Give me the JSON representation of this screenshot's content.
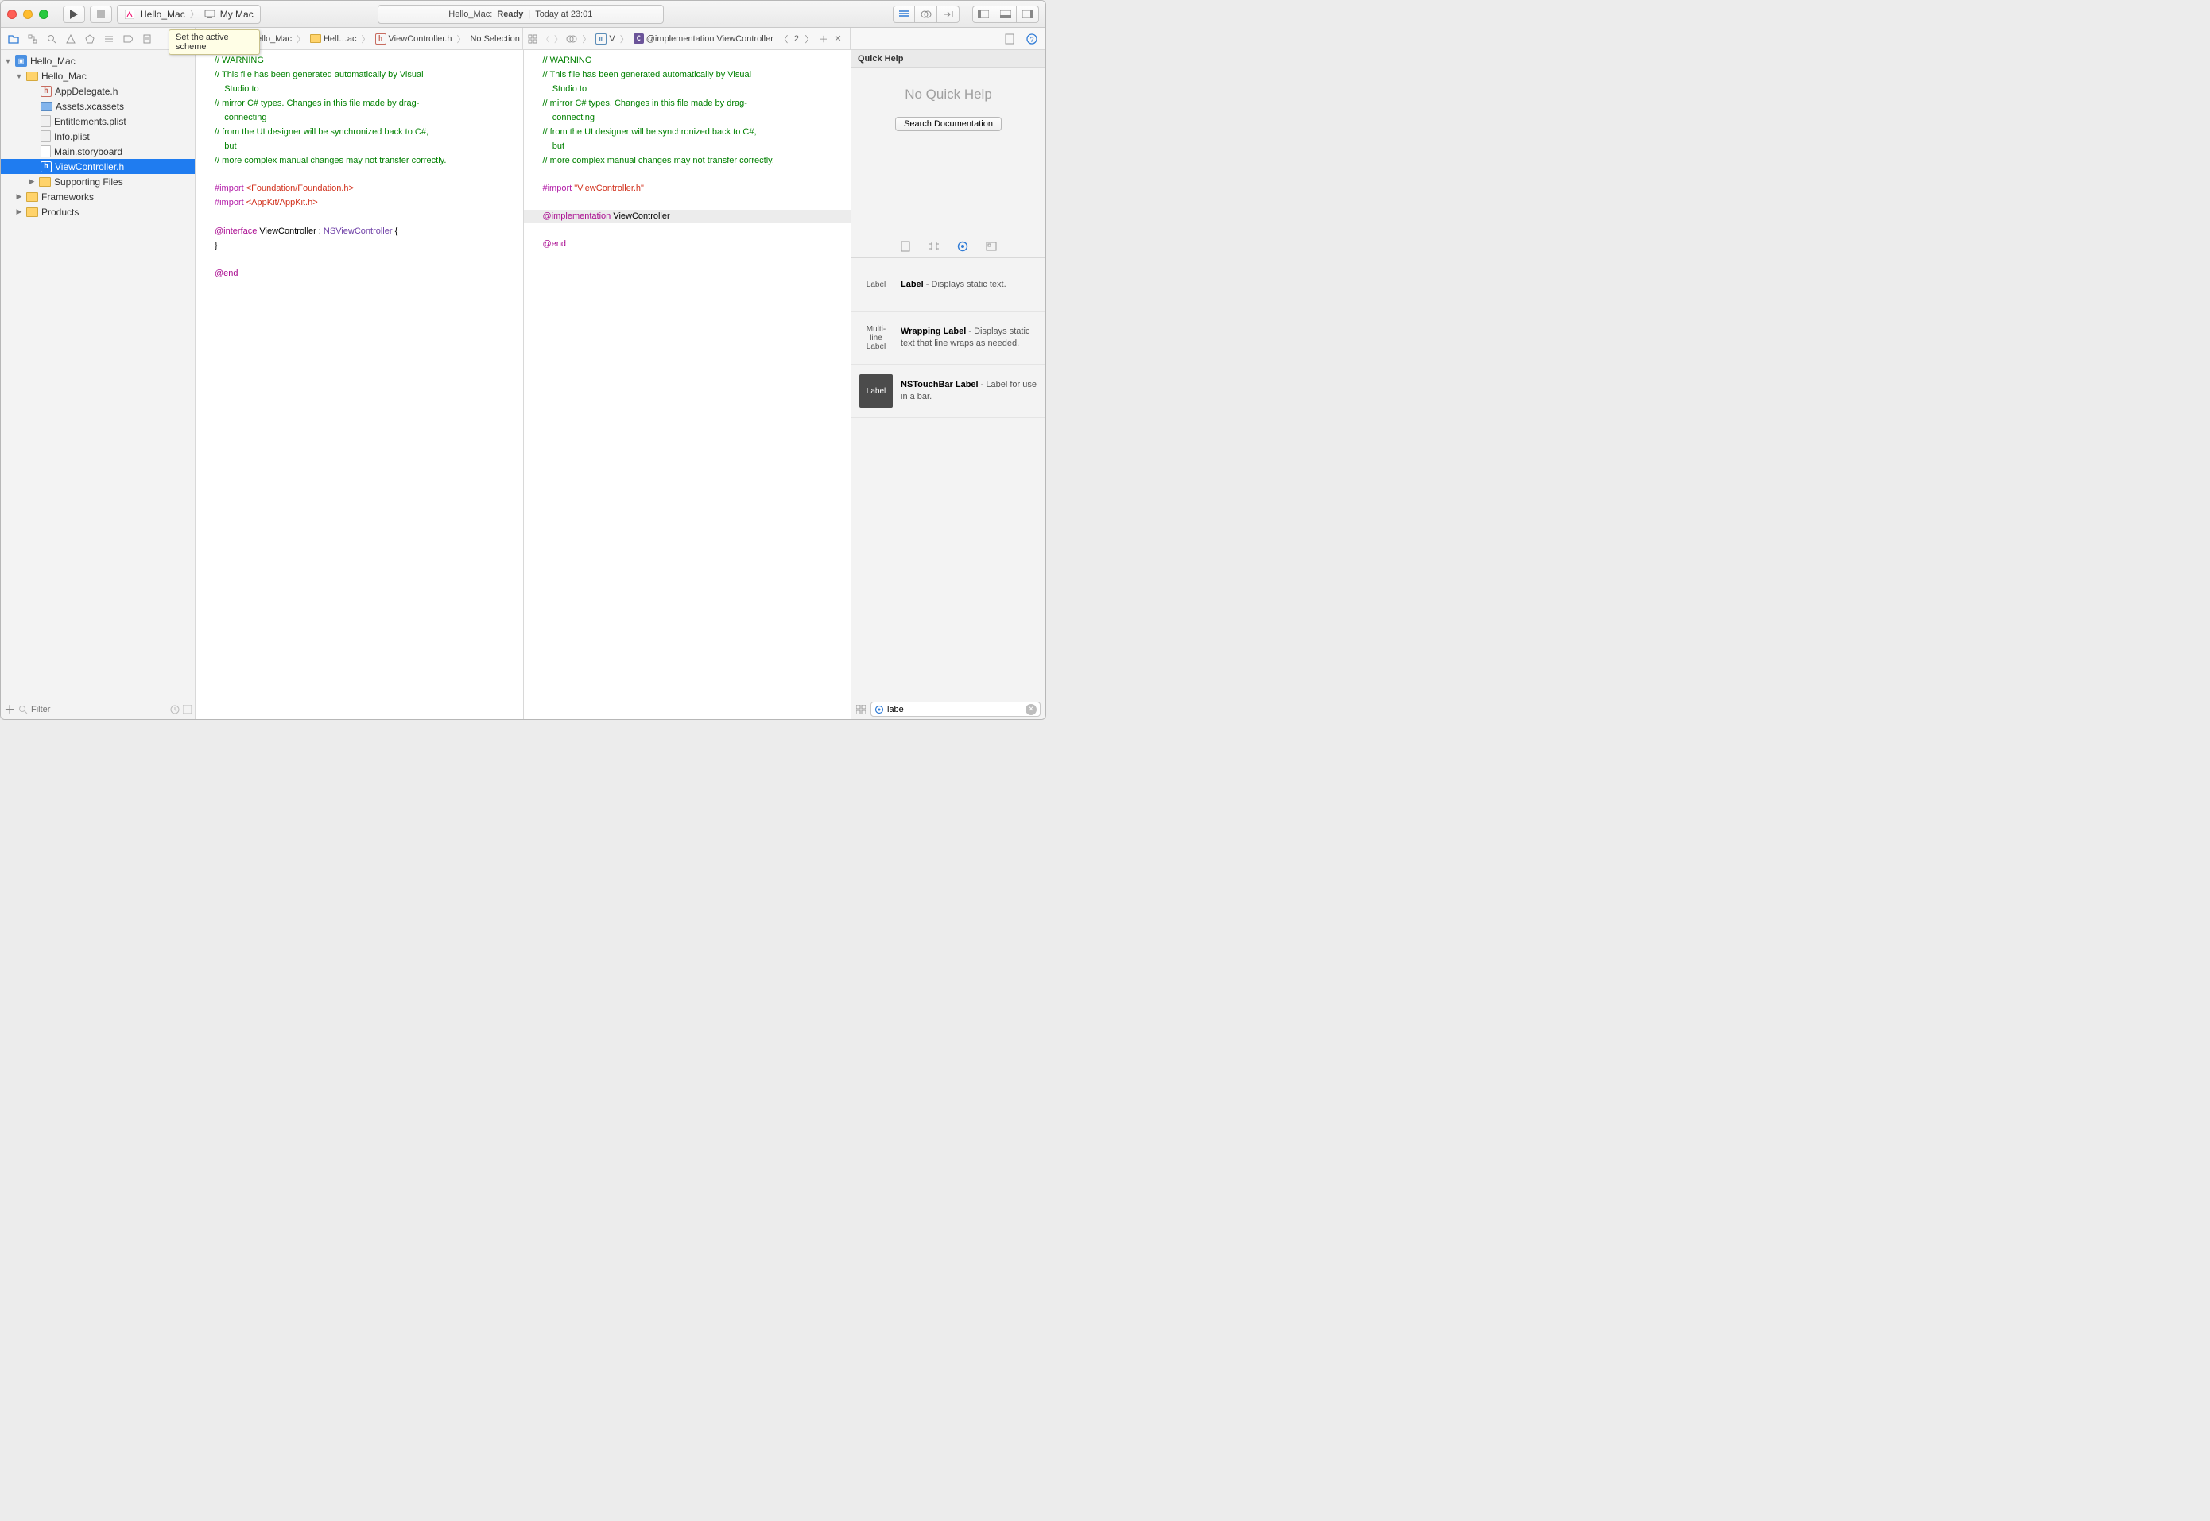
{
  "tooltip": "Set the active scheme",
  "scheme": {
    "name": "Hello_Mac",
    "destination": "My Mac"
  },
  "status": {
    "project": "Hello_Mac:",
    "state": "Ready",
    "time": "Today at 23:01"
  },
  "navigator": {
    "root": "Hello_Mac",
    "grp1": "Hello_Mac",
    "files": {
      "appdelegate": "AppDelegate.h",
      "assets": "Assets.xcassets",
      "entitlements": "Entitlements.plist",
      "info": "Info.plist",
      "storyboard": "Main.storyboard",
      "viewcontroller": "ViewController.h",
      "supporting": "Supporting Files"
    },
    "frameworks": "Frameworks",
    "products": "Products",
    "filter_placeholder": "Filter"
  },
  "jump_left": {
    "project": "Hello_Mac",
    "group": "Hell…ac",
    "file": "ViewController.h",
    "selection": "No Selection"
  },
  "jump_right": {
    "file_char": "V",
    "symbol": "@implementation ViewController",
    "count": "2"
  },
  "code_left": {
    "c1": "// WARNING",
    "c2": "// This file has been generated automatically by Visual",
    "c2b": "    Studio to",
    "c3": "// mirror C# types. Changes in this file made by drag-",
    "c3b": "    connecting",
    "c4": "// from the UI designer will be synchronized back to C#,",
    "c4b": "    but",
    "c5": "// more complex manual changes may not transfer correctly.",
    "import": "#import",
    "foundation": " <Foundation/Foundation.h>",
    "appkit": " <AppKit/AppKit.h>",
    "interface": "@interface",
    "class": " ViewController : ",
    "super": "NSViewController",
    "brace": " {",
    "brace2": "}",
    "end": "@end"
  },
  "code_right": {
    "header": "\"ViewController.h\"",
    "impl": "@implementation",
    "class": " ViewController",
    "end": "@end"
  },
  "inspector": {
    "title": "Quick Help",
    "nohelp": "No Quick Help",
    "searchdocs": "Search Documentation"
  },
  "library": {
    "items": [
      {
        "thumb_style": "light",
        "thumb": "Label",
        "title": "Label",
        "desc": " - Displays static text."
      },
      {
        "thumb_style": "light",
        "thumb": "Multi-\nline\nLabel",
        "title": "Wrapping Label",
        "desc": " - Displays static text that line wraps as needed."
      },
      {
        "thumb_style": "dark",
        "thumb": "Label",
        "title": "NSTouchBar Label",
        "desc": " - Label for use in a bar."
      }
    ],
    "search": "labe"
  }
}
